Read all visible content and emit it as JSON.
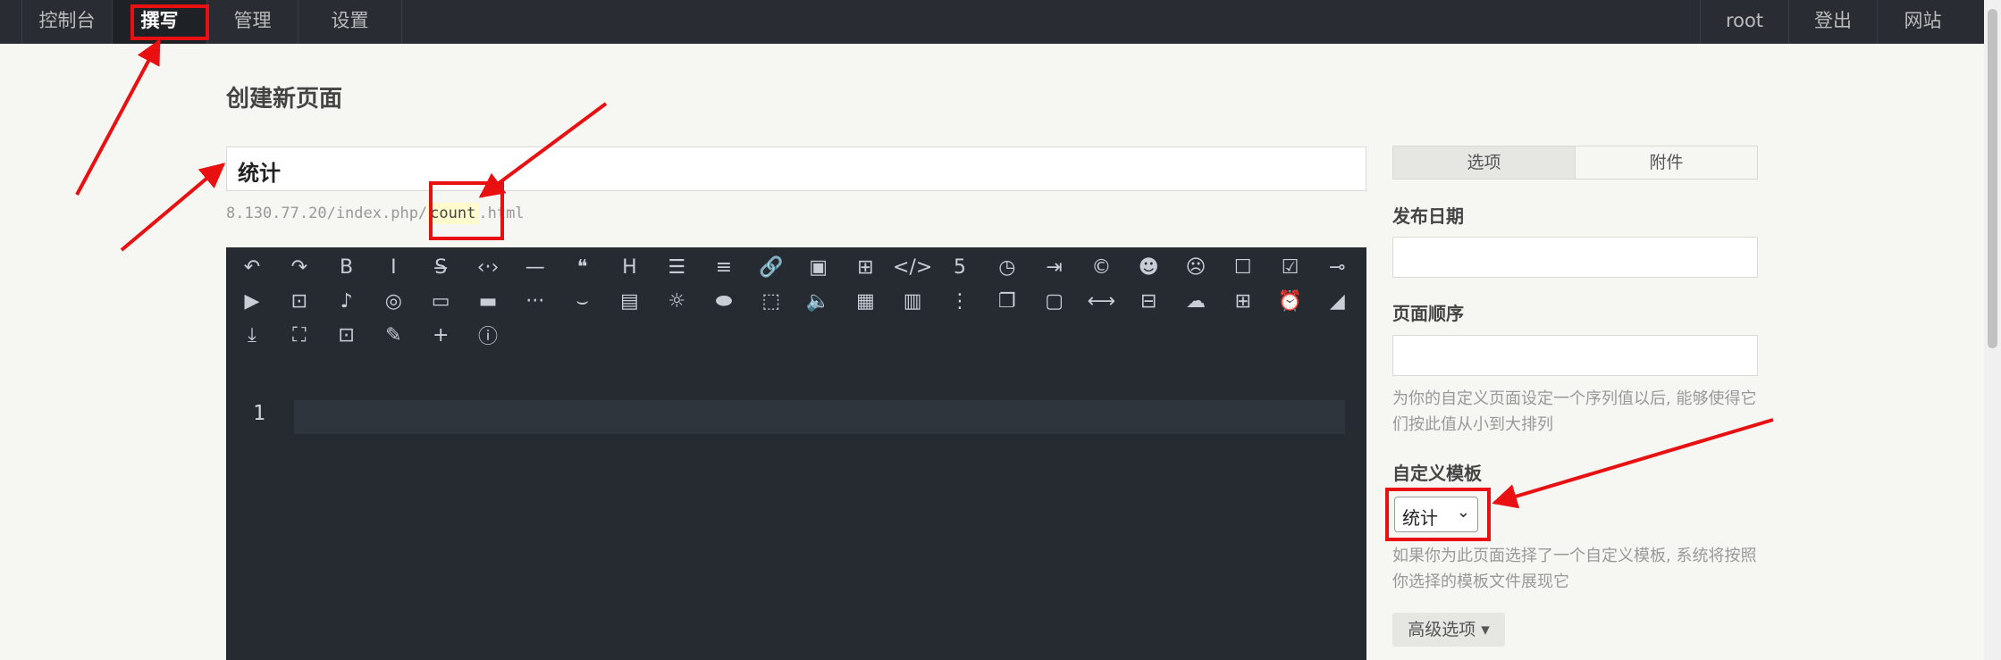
{
  "nav": {
    "left": [
      "控制台",
      "撰写",
      "管理",
      "设置"
    ],
    "right": [
      "root",
      "登出",
      "网站"
    ]
  },
  "page": {
    "title": "创建新页面"
  },
  "editor_form": {
    "title_value": "统计",
    "slug_prefix": "8.130.77.20/index.php/",
    "slug": "count",
    "slug_suffix": ".html",
    "line_number": "1"
  },
  "toolbar_icons": [
    "undo-icon",
    "redo-icon",
    "bold-icon",
    "italic-icon",
    "strikethrough-icon",
    "inline-code-icon",
    "horizontal-rule-icon",
    "quote-icon",
    "heading-icon",
    "ordered-list-icon",
    "unordered-list-icon",
    "link-icon",
    "image-icon",
    "table-icon",
    "code-block-icon",
    "html5-icon",
    "clock-icon",
    "skip-icon",
    "copyright-icon",
    "emoji-happy-icon",
    "emoji-sad-icon",
    "checkbox-empty-icon",
    "checkbox-checked-icon",
    "commit-icon",
    "video-icon",
    "bilibili-icon",
    "music-icon",
    "netease-music-icon",
    "btn-icon",
    "card-icon",
    "more-dots-icon",
    "hide-icon",
    "text-box-icon",
    "tips-icon",
    "toggle-icon",
    "dashed-box-icon",
    "audio-icon",
    "gallery-icon",
    "note-icon",
    "timeline-icon",
    "copy-icon",
    "folder-icon",
    "divider-icon",
    "tab-icon",
    "cloud-icon",
    "grid-icon",
    "alarm-icon",
    "eraser-icon",
    "download-icon",
    "fullscreen-icon",
    "preview-icon",
    "pen-icon",
    "plus-icon",
    "info-icon"
  ],
  "sidebar": {
    "tabs": [
      "选项",
      "附件"
    ],
    "publish_date_label": "发布日期",
    "order_label": "页面顺序",
    "order_desc": "为你的自定义页面设定一个序列值以后, 能够使得它们按此值从小到大排列",
    "template_label": "自定义模板",
    "template_selected": "统计",
    "template_desc": "如果你为此页面选择了一个自定义模板, 系统将按照你选择的模板文件展现它",
    "advanced_button": "高级选项 ▾"
  },
  "colors": {
    "annotation": "#e81010",
    "nav_bg": "#292d33",
    "editor_bg": "#262b32"
  }
}
